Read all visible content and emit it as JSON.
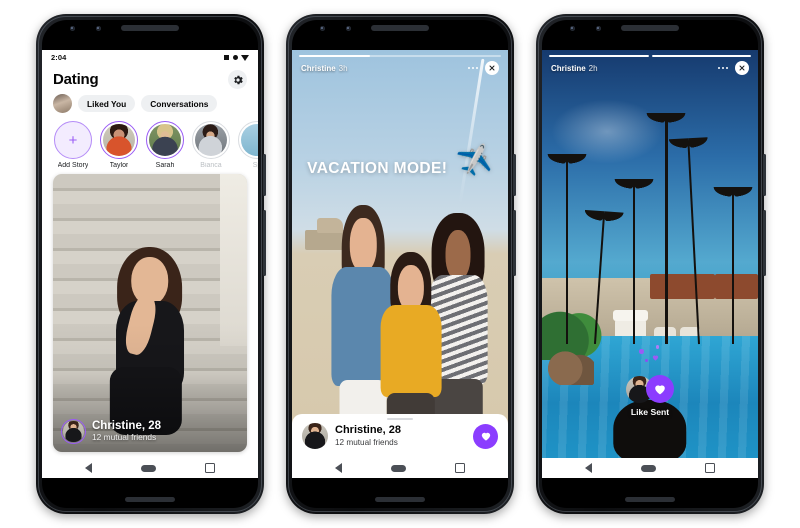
{
  "accent": {
    "purple": "#8b3dff",
    "purple_ring": "#9a5cf5",
    "pill_bg": "#eef0f2",
    "bezel": "#15171a"
  },
  "phone1": {
    "status_bar": {
      "time": "2:04",
      "icons": [
        "battery-icon",
        "signal-dot-icon",
        "wifi-icon"
      ]
    },
    "header": {
      "title": "Dating",
      "settings_icon": "gear-icon"
    },
    "filters": {
      "avatar": "me-avatar",
      "pills": [
        "Liked You",
        "Conversations"
      ]
    },
    "stories": [
      {
        "label": "Add Story",
        "state": "add",
        "icon": "plus-icon"
      },
      {
        "label": "Taylor",
        "state": "unseen"
      },
      {
        "label": "Sarah",
        "state": "unseen"
      },
      {
        "label": "Bianca",
        "state": "seen"
      },
      {
        "label": "Sp",
        "state": "seen"
      }
    ],
    "profile_card": {
      "name": "Christine, 28",
      "mutual": "12 mutual friends"
    },
    "nav": {
      "back": "back-icon",
      "home": "home-icon",
      "recents": "recents-icon"
    }
  },
  "phone2": {
    "story": {
      "user": "Christine",
      "time": "3h",
      "sticker_text": "VACATION MODE!",
      "sticker_emoji": "✈️",
      "menu_icon": "more-options-icon",
      "close_icon": "close-icon",
      "progress": [
        {
          "fill": 35
        }
      ]
    },
    "sheet": {
      "name": "Christine, 28",
      "mutual": "12 mutual friends",
      "like_icon": "heart-icon"
    },
    "nav": {
      "back": "back-icon",
      "home": "home-icon",
      "recents": "recents-icon"
    }
  },
  "phone3": {
    "story": {
      "user": "Christine",
      "time": "2h",
      "menu_icon": "more-options-icon",
      "close_icon": "close-icon",
      "progress": [
        {
          "fill": 100
        },
        {
          "fill": 100
        }
      ]
    },
    "confirmation": {
      "label": "Like Sent",
      "icon": "heart-icon"
    },
    "nav": {
      "back": "back-icon",
      "home": "home-icon",
      "recents": "recents-icon"
    }
  }
}
